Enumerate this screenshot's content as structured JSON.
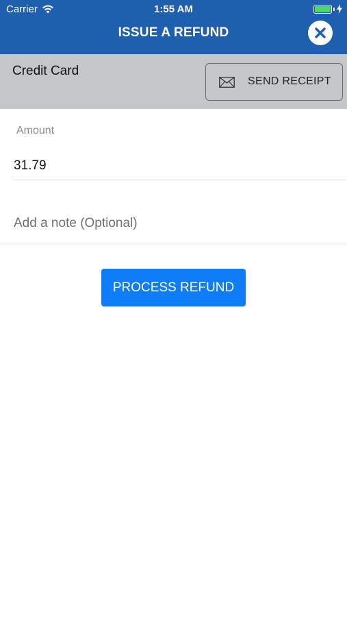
{
  "status_bar": {
    "carrier": "Carrier",
    "time": "1:55 AM",
    "battery_color": "#4cd964"
  },
  "header": {
    "title": "ISSUE A REFUND",
    "background": "#1f5fb0",
    "close_icon": "close-icon"
  },
  "payment": {
    "type_label": "Credit Card",
    "send_receipt_label": "SEND RECEIPT",
    "send_receipt_icon": "envelope-icon"
  },
  "form": {
    "amount_label": "Amount",
    "amount_value": "31.79",
    "note_placeholder": "Add a note (Optional)",
    "note_value": ""
  },
  "actions": {
    "process_label": "PROCESS REFUND",
    "process_color": "#0f7cf8"
  }
}
